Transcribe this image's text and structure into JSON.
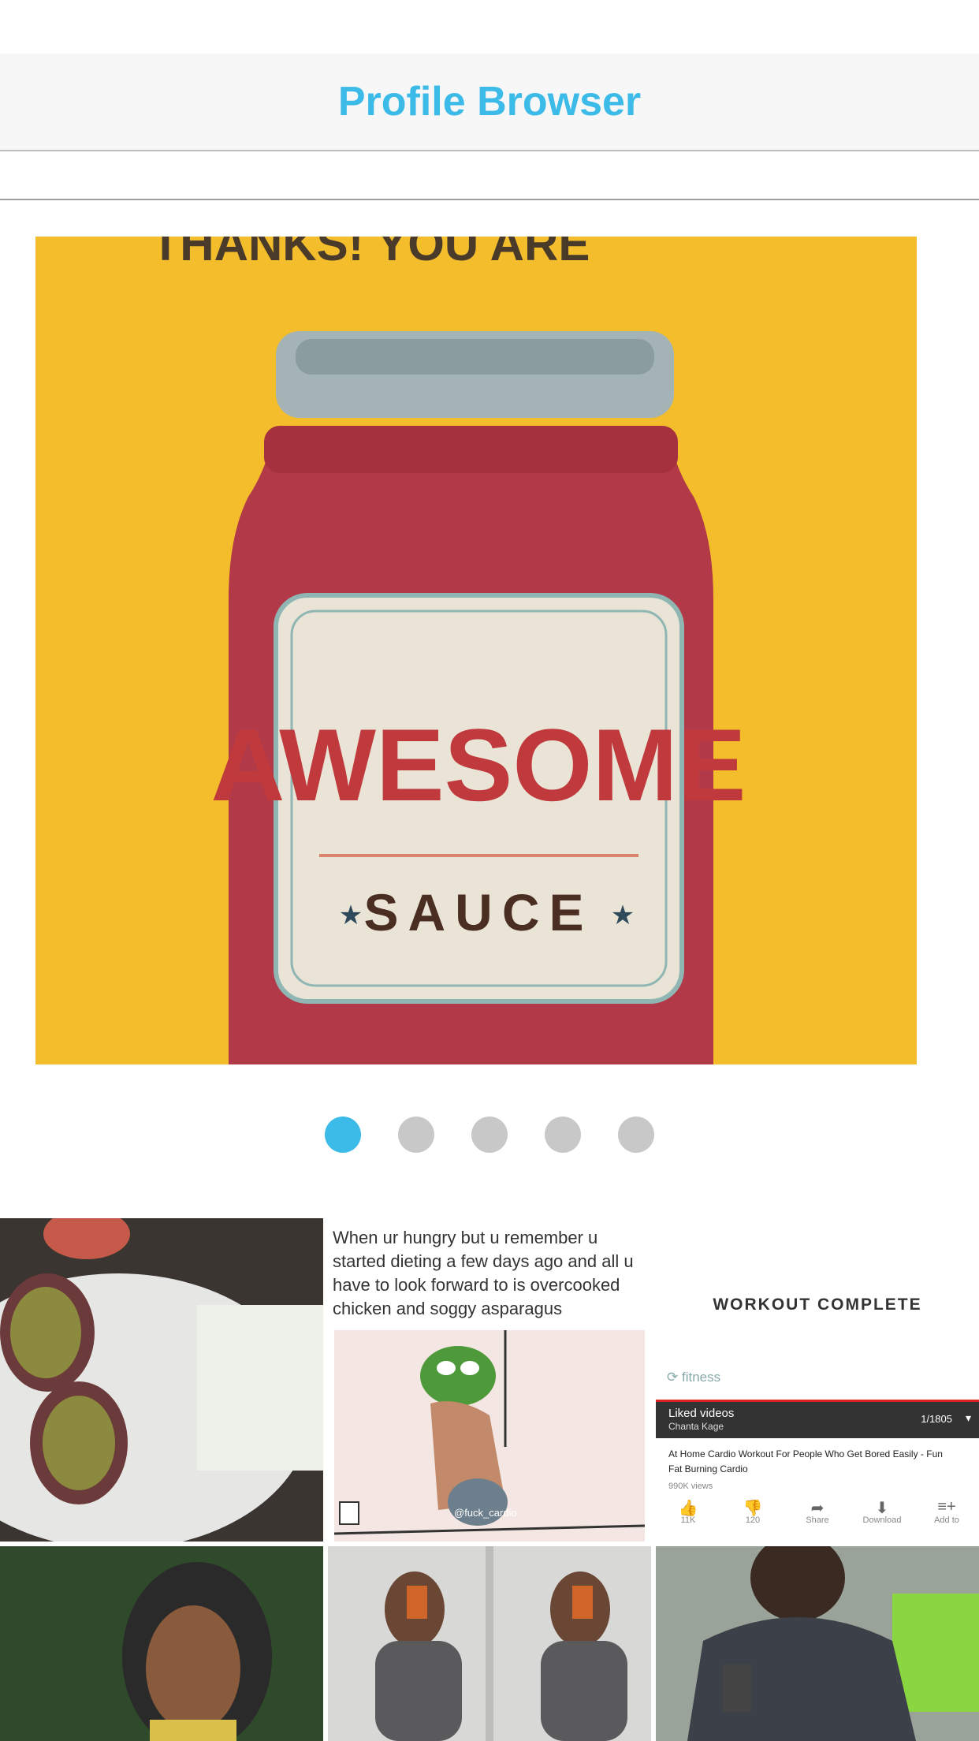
{
  "nav": {
    "title": "Profile Browser"
  },
  "hero": {
    "top_text": "THANKS! YOU ARE",
    "jar_title": "AWESOME",
    "jar_subtitle": "SAUCE"
  },
  "carousel": {
    "page_count": 5,
    "active_index": 0
  },
  "grid": {
    "meme": {
      "caption": "When ur hungry but u remember u started dieting a few days ago and all u have to look forward to is overcooked chicken and soggy asparagus",
      "watermark": "@fuck_cardio"
    },
    "workout": {
      "title": "WORKOUT COMPLETE",
      "brand": "fitness",
      "playlist_label": "Liked videos",
      "playlist_owner": "Chanta Kage",
      "playlist_position": "1/1805",
      "video_title": "At Home Cardio Workout For People Who Get Bored Easily - Fun Fat Burning Cardio",
      "views": "990K views",
      "actions": [
        {
          "icon": "thumbs-up-icon",
          "label": "11K"
        },
        {
          "icon": "thumbs-down-icon",
          "label": "120"
        },
        {
          "icon": "share-icon",
          "label": "Share"
        },
        {
          "icon": "download-icon",
          "label": "Download"
        },
        {
          "icon": "add-to-icon",
          "label": "Add to"
        }
      ]
    }
  },
  "colors": {
    "accent": "#3dbbe8",
    "dot_inactive": "#c8c8c8",
    "hero_bg": "#f3bd2c",
    "jar_red": "#b23a48"
  }
}
